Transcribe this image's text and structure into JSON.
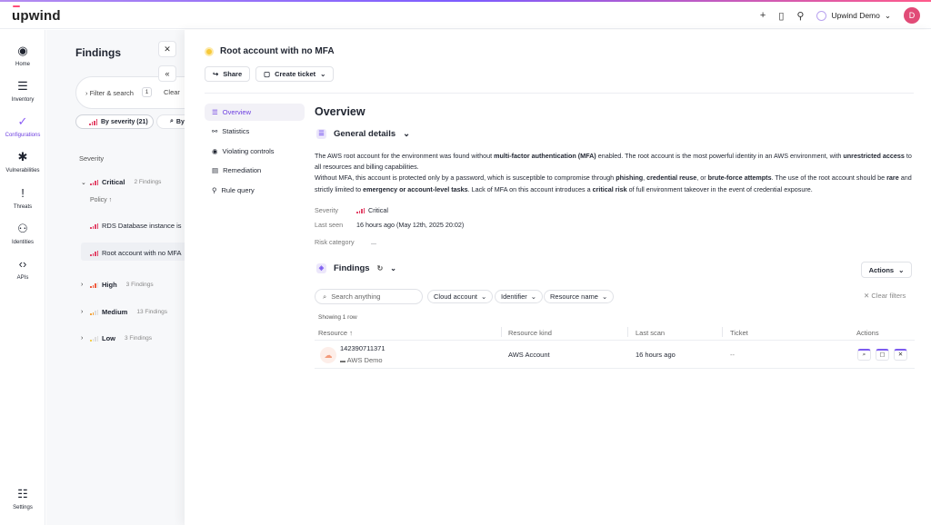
{
  "app": {
    "logo": "upwind"
  },
  "topbar": {
    "plus_icon": "+",
    "book_icon": "▯",
    "person_icon": "⚲",
    "org_name": "Upwind Demo",
    "avatar_initial": "D"
  },
  "sidebar": {
    "items": [
      {
        "label": "Home",
        "icon": "◉"
      },
      {
        "label": "Inventory",
        "icon": "☰"
      },
      {
        "label": "Configurations",
        "icon": "✓"
      },
      {
        "label": "Vulnerabilities",
        "icon": "✱"
      },
      {
        "label": "Threats",
        "icon": "!"
      },
      {
        "label": "Identities",
        "icon": "⚇"
      },
      {
        "label": "APIs",
        "icon": "‹›"
      },
      {
        "label": "Settings",
        "icon": "☷"
      }
    ]
  },
  "findings_panel": {
    "title": "Findings",
    "filter_label": "Filter & search",
    "filter_count": "1",
    "clear_label": "Clear",
    "tab_severity": "By severity (21)",
    "tab_other": "By",
    "severity_header": "Severity",
    "groups": [
      {
        "name": "Critical",
        "count": "2 Findings"
      },
      {
        "name": "High",
        "count": "3 Findings"
      },
      {
        "name": "Medium",
        "count": "13 Findings"
      },
      {
        "name": "Low",
        "count": "3 Findings"
      }
    ],
    "policy_header": "Policy",
    "critical_items": [
      "RDS Database instance is",
      "Root account with no MFA"
    ]
  },
  "detail": {
    "title": "Root account with no MFA",
    "share_label": "Share",
    "create_ticket_label": "Create ticket",
    "nav": [
      "Overview",
      "Statistics",
      "Violating controls",
      "Remediation",
      "Rule query"
    ],
    "overview_title": "Overview",
    "general_details_title": "General details",
    "description": {
      "p1a": "The AWS root account for the environment was found without ",
      "p1b": "multi-factor authentication (MFA)",
      "p1c": " enabled. The root account is the most powerful identity in an AWS environment, with ",
      "p1d": "unrestricted access",
      "p1e": " to all resources and billing capabilities.",
      "p2a": "Without MFA, this account is protected only by a password, which is susceptible to compromise through ",
      "p2b": "phishing",
      "p2c": ", ",
      "p2d": "credential reuse",
      "p2e": ", or ",
      "p2f": "brute-force attempts",
      "p2g": ". The use of the root account should be ",
      "p2h": "rare",
      "p2i": " and strictly limited to ",
      "p2j": "emergency or account-level tasks",
      "p2k": ". Lack of MFA on this account introduces a ",
      "p2l": "critical risk",
      "p2m": " of full environment takeover in the event of credential exposure."
    },
    "meta": {
      "severity_label": "Severity",
      "severity_value": "Critical",
      "last_seen_label": "Last seen",
      "last_seen_value": "16 hours ago (May 12th, 2025 20:02)",
      "risk_label": "Risk category",
      "risk_value": "..."
    },
    "findings_section": {
      "title": "Findings",
      "actions_label": "Actions",
      "search_placeholder": "Search anything",
      "chips": [
        "Cloud account",
        "Identifier",
        "Resource name"
      ],
      "clear_filters": "Clear filters",
      "showing": "Showing 1 row",
      "columns": [
        "Resource",
        "Resource kind",
        "Last scan",
        "Ticket",
        "Actions"
      ],
      "rows": [
        {
          "resource_id": "142390711371",
          "resource_account": "AWS Demo",
          "kind": "AWS Account",
          "last_scan": "16 hours ago",
          "ticket": "--"
        }
      ]
    }
  }
}
